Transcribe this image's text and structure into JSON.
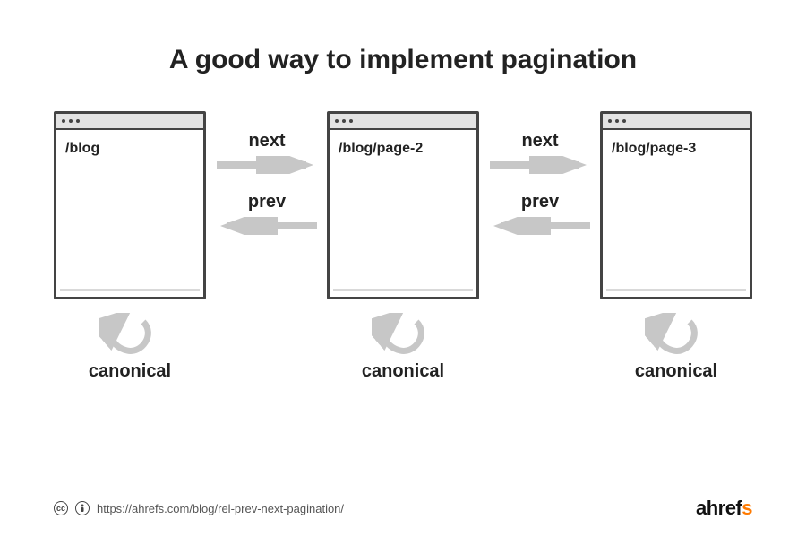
{
  "title": "A good way to implement pagination",
  "browsers": [
    {
      "url": "/blog"
    },
    {
      "url": "/blog/page-2"
    },
    {
      "url": "/blog/page-3"
    }
  ],
  "labels": {
    "next": "next",
    "prev": "prev",
    "canonical": "canonical"
  },
  "footer": {
    "url": "https://ahrefs.com/blog/rel-prev-next-pagination/",
    "brand_prefix": "ahref",
    "brand_suffix": "s"
  },
  "colors": {
    "arrow": "#c7c7c7",
    "accent": "#ff7a00"
  }
}
